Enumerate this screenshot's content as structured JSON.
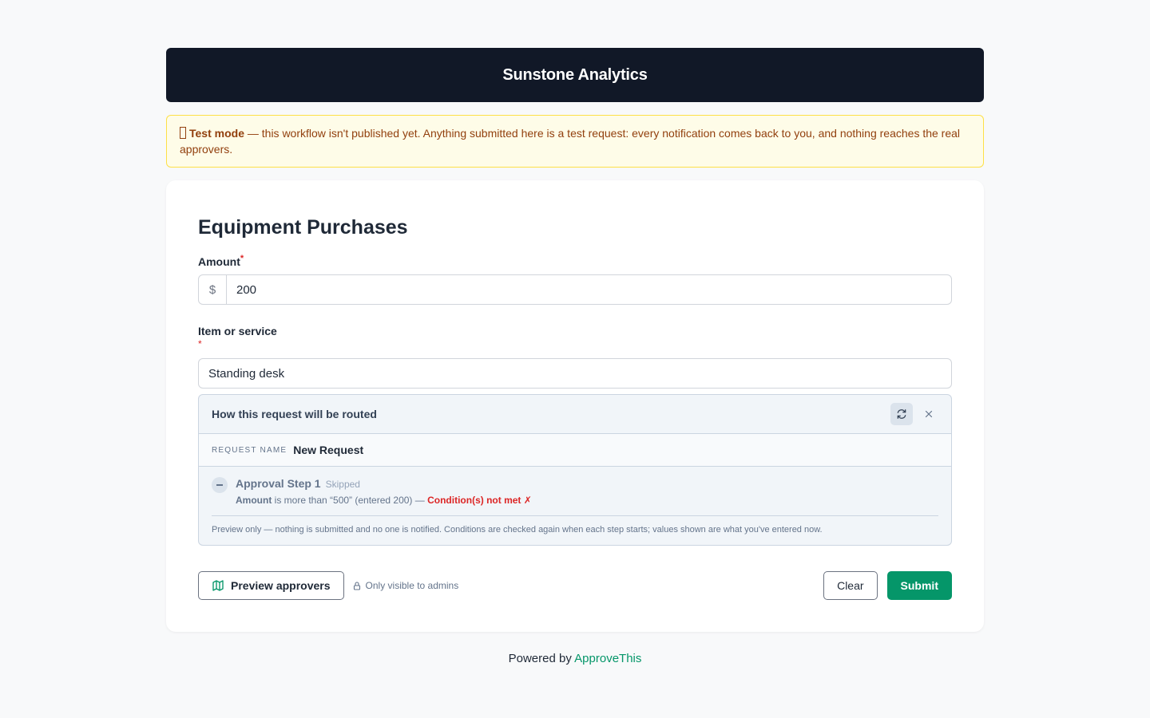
{
  "header": {
    "title": "Sunstone Analytics"
  },
  "banner": {
    "strong": "Test mode",
    "text": " — this workflow isn't published yet. Anything submitted here is a test request: every notification comes back to you, and nothing reaches the real approvers."
  },
  "form": {
    "title": "Equipment Purchases",
    "amount": {
      "label": "Amount",
      "required_mark": "*",
      "prefix": "$",
      "value": "200"
    },
    "item": {
      "label": "Item or service",
      "required_mark": "*",
      "value": "Standing desk"
    }
  },
  "routing": {
    "title": "How this request will be routed",
    "request_name_label": "REQUEST NAME",
    "request_name_value": "New Request",
    "steps": [
      {
        "name": "Approval Step 1",
        "status": "Skipped",
        "field": "Amount",
        "condition": " is more than “500” (entered 200) — ",
        "result": "Condition(s) not met ✗"
      }
    ],
    "note": "Preview only — nothing is submitted and no one is notified. Conditions are checked again when each step starts; values shown are what you've entered now."
  },
  "actions": {
    "preview_label": "Preview approvers",
    "admin_note": "Only visible to admins",
    "clear_label": "Clear",
    "submit_label": "Submit"
  },
  "footer": {
    "prefix": "Powered by ",
    "brand": "ApproveThis"
  },
  "icons": {
    "warning": "warning-icon",
    "refresh": "refresh-icon",
    "close": "close-icon",
    "step": "minus-circle-icon",
    "map": "map-icon",
    "lock": "lock-icon"
  },
  "colors": {
    "header_bg": "#111827",
    "accent": "#059669",
    "banner_bg": "#fefce8",
    "banner_text": "#92400e",
    "error": "#dc2626"
  }
}
